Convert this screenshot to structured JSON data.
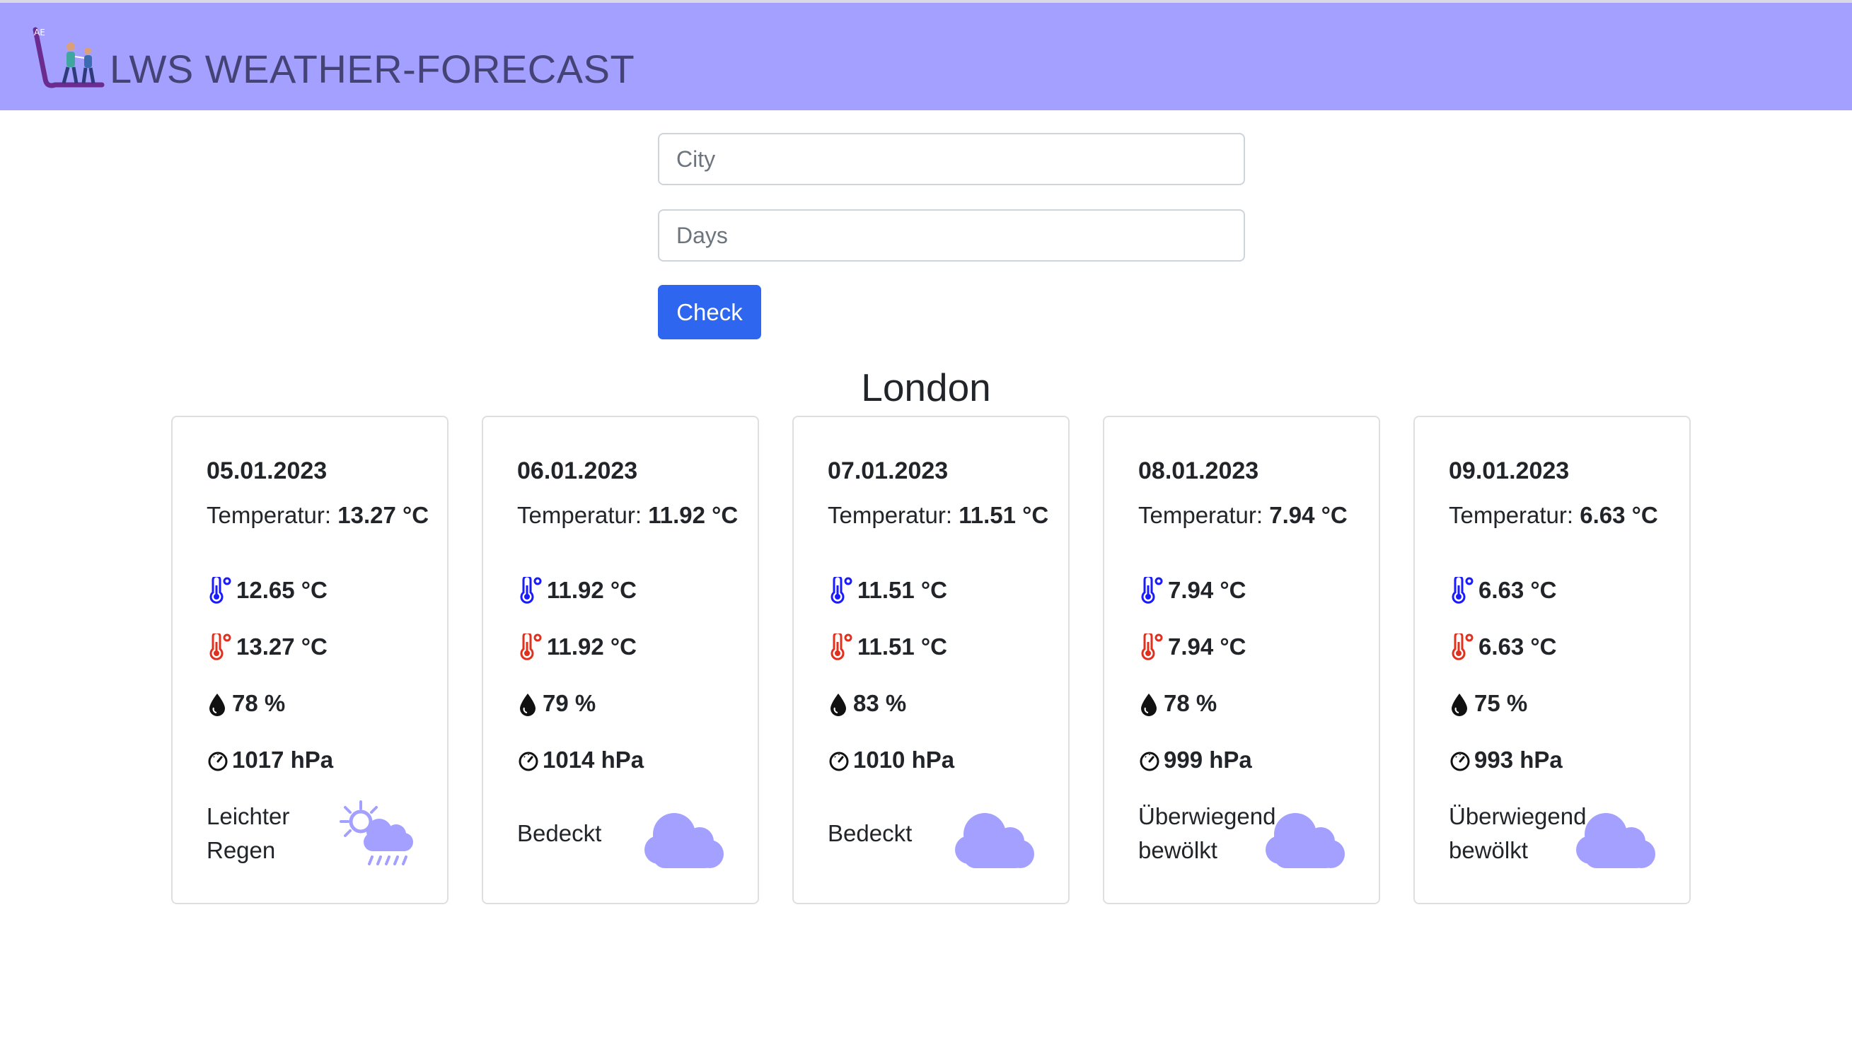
{
  "header": {
    "title": "LWS WEATHER-FORECAST",
    "background": "#a3a0ff"
  },
  "form": {
    "city_placeholder": "City",
    "days_placeholder": "Days",
    "check_label": "Check"
  },
  "city": "London",
  "forecast": [
    {
      "date": "05.01.2023",
      "temp_label": "Temperatur:",
      "temp": "13.27 °C",
      "min": "12.65 °C",
      "max": "13.27 °C",
      "humidity": "78 %",
      "pressure": "1017 hPa",
      "condition": "Leichter Regen",
      "icon": "sun-cloud-rain-icon"
    },
    {
      "date": "06.01.2023",
      "temp_label": "Temperatur:",
      "temp": "11.92 °C",
      "min": "11.92 °C",
      "max": "11.92 °C",
      "humidity": "79 %",
      "pressure": "1014 hPa",
      "condition": "Bedeckt",
      "icon": "cloud-icon"
    },
    {
      "date": "07.01.2023",
      "temp_label": "Temperatur:",
      "temp": "11.51 °C",
      "min": "11.51 °C",
      "max": "11.51 °C",
      "humidity": "83 %",
      "pressure": "1010 hPa",
      "condition": "Bedeckt",
      "icon": "cloud-icon"
    },
    {
      "date": "08.01.2023",
      "temp_label": "Temperatur:",
      "temp": "7.94 °C",
      "min": "7.94 °C",
      "max": "7.94 °C",
      "humidity": "78 %",
      "pressure": "999 hPa",
      "condition": "Überwiegend bewölkt",
      "icon": "cloud-icon"
    },
    {
      "date": "09.01.2023",
      "temp_label": "Temperatur:",
      "temp": "6.63 °C",
      "min": "6.63 °C",
      "max": "6.63 °C",
      "humidity": "75 %",
      "pressure": "993 hPa",
      "condition": "Überwiegend bewölkt",
      "icon": "cloud-icon"
    }
  ],
  "colors": {
    "min_temp_icon": "#1a1aff",
    "max_temp_icon": "#e0301e",
    "weather_icon": "#a3a0ff",
    "button": "#2f66f0"
  }
}
